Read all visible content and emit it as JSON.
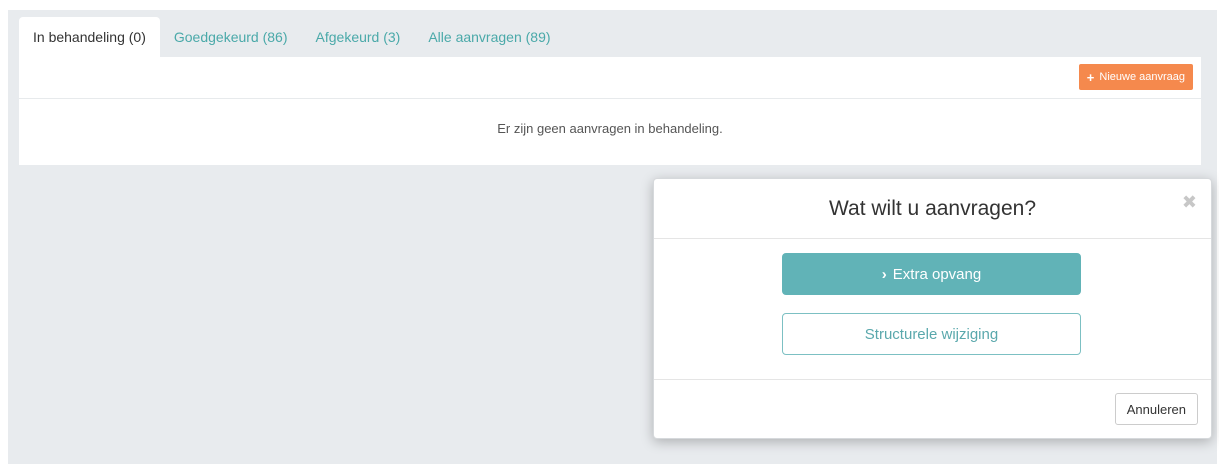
{
  "tabs": [
    {
      "label": "In behandeling (0)",
      "active": true
    },
    {
      "label": "Goedgekeurd (86)",
      "active": false
    },
    {
      "label": "Afgekeurd (3)",
      "active": false
    },
    {
      "label": "Alle aanvragen (89)",
      "active": false
    }
  ],
  "toolbar": {
    "new_request_label": "Nieuwe aanvraag",
    "new_request_icon": "plus-icon"
  },
  "main": {
    "empty_message": "Er zijn geen aanvragen in behandeling."
  },
  "modal": {
    "title": "Wat wilt u aanvragen?",
    "close_icon": "close-icon",
    "options": [
      {
        "label": "Extra opvang",
        "icon": "chevron-right-icon"
      },
      {
        "label": "Structurele wijziging"
      }
    ],
    "cancel_label": "Annuleren"
  },
  "colors": {
    "accent": "#4aa9a9",
    "primary_button": "#61b3b7",
    "new_request_button": "#f5894d",
    "background": "#e8ebee"
  }
}
